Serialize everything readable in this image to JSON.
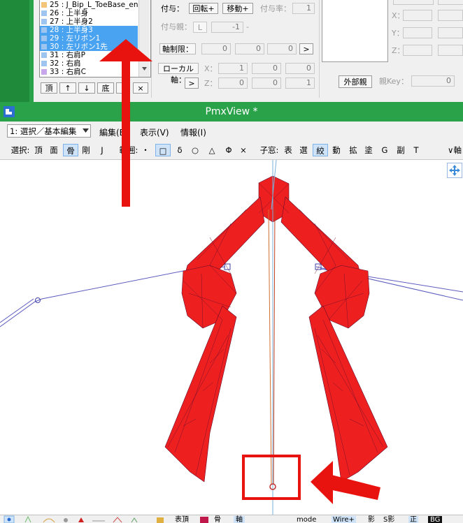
{
  "bone_list": {
    "items": [
      {
        "label": "25 : J_Bip_L_ToeBase_en",
        "color": "#f4c478",
        "selected": false
      },
      {
        "label": "26 : 上半身",
        "color": "#9ec4f0",
        "selected": false
      },
      {
        "label": "27 : 上半身2",
        "color": "#9ec4f0",
        "selected": false
      },
      {
        "label": "28 : 上半身3",
        "color": "#9ec4f0",
        "selected": true
      },
      {
        "label": "29 : 左リボン1",
        "color": "#9ec4f0",
        "selected": true
      },
      {
        "label": "30 : 左リボン1先",
        "color": "#9ec4f0",
        "selected": true
      },
      {
        "label": "31 : 右肩P",
        "color": "#9ec4f0",
        "selected": false
      },
      {
        "label": "32 : 右肩",
        "color": "#9ec4f0",
        "selected": false
      },
      {
        "label": "33 : 右肩C",
        "color": "#c7a6ec",
        "selected": false
      }
    ],
    "nav_buttons": [
      "頂",
      "↑",
      "↓",
      "底",
      "",
      "×"
    ]
  },
  "props": {
    "fuyo_label": "付与：",
    "rot_button": "回転+",
    "move_button": "移動+",
    "fuyo_rate_label": "付与率：",
    "fuyo_rate_value": "1",
    "fuyo_parent_label": "付与親：",
    "fuyo_parent_btn": "L",
    "fuyo_parent_value": "-1",
    "fuyo_parent_dash": "-",
    "axis_limit_label": "軸制限：",
    "axis_limit_values": [
      "0",
      "0",
      "0"
    ],
    "axis_limit_arrow": ">",
    "local_axis_label": "ローカル軸：",
    "local_x_label": "X：",
    "local_x_values": [
      "1",
      "0",
      "0"
    ],
    "local_arrow": ">",
    "local_z_label": "Z：",
    "local_z_values": [
      "0",
      "0",
      "1"
    ],
    "right_x_label": "X：",
    "right_y_label": "Y：",
    "right_z_label": "Z：",
    "external_parent_button": "外部親",
    "parent_key_label": "親Key：",
    "parent_key_value": "0"
  },
  "window": {
    "title": "PmxView *"
  },
  "menu": {
    "mode_select": "1: 選択／基本編集",
    "items": [
      "編集(E)",
      "表示(V)",
      "情報(I)"
    ]
  },
  "toolbar": {
    "select_label": "選択:",
    "select_items": [
      "頂",
      "面",
      "骨",
      "剛",
      "J"
    ],
    "range_label": "範囲:",
    "range_items": [
      "・",
      "□",
      "δ",
      "○",
      "△",
      "Φ",
      "×"
    ],
    "child_label": "子窓:",
    "child_items": [
      "表",
      "選",
      "絞",
      "動",
      "拡",
      "塗",
      "G",
      "副",
      "T"
    ],
    "axis_label": "∨軸"
  },
  "bottombar": {
    "items": [
      "表頂",
      "骨",
      "軸",
      "mode",
      "Wire+",
      "影",
      "S影",
      "正",
      "BG"
    ]
  },
  "colors": {
    "model_red": "#ee1f1f",
    "annotation_red": "#e8120f",
    "title_green": "#2aa24a",
    "selection_blue": "#4aa3f0"
  }
}
